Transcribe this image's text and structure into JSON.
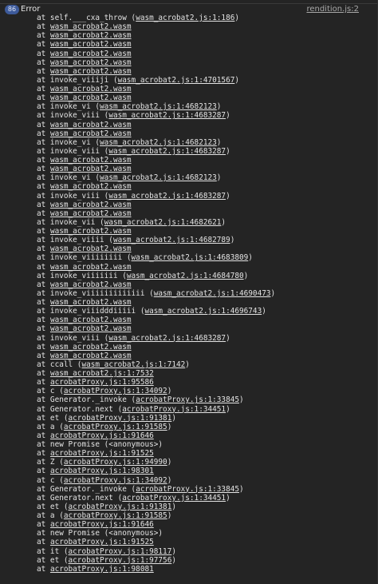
{
  "header": {
    "count": "86",
    "label": "Error",
    "source": "rendition.js:2"
  },
  "stack": [
    {
      "prefix": "at self.___cxa_throw (",
      "link": "wasm_acrobat2.js:1:186",
      "suffix": ")"
    },
    {
      "prefix": "at ",
      "link": "wasm_acrobat2.wasm",
      "suffix": ""
    },
    {
      "prefix": "at ",
      "link": "wasm_acrobat2.wasm",
      "suffix": ""
    },
    {
      "prefix": "at ",
      "link": "wasm_acrobat2.wasm",
      "suffix": ""
    },
    {
      "prefix": "at ",
      "link": "wasm_acrobat2.wasm",
      "suffix": ""
    },
    {
      "prefix": "at ",
      "link": "wasm_acrobat2.wasm",
      "suffix": ""
    },
    {
      "prefix": "at ",
      "link": "wasm_acrobat2.wasm",
      "suffix": ""
    },
    {
      "prefix": "at invoke_viiiji (",
      "link": "wasm_acrobat2.js:1:4701567",
      "suffix": ")"
    },
    {
      "prefix": "at ",
      "link": "wasm_acrobat2.wasm",
      "suffix": ""
    },
    {
      "prefix": "at ",
      "link": "wasm_acrobat2.wasm",
      "suffix": ""
    },
    {
      "prefix": "at invoke_vi (",
      "link": "wasm_acrobat2.js:1:4682123",
      "suffix": ")"
    },
    {
      "prefix": "at invoke_viii (",
      "link": "wasm_acrobat2.js:1:4683287",
      "suffix": ")"
    },
    {
      "prefix": "at ",
      "link": "wasm_acrobat2.wasm",
      "suffix": ""
    },
    {
      "prefix": "at ",
      "link": "wasm_acrobat2.wasm",
      "suffix": ""
    },
    {
      "prefix": "at invoke_vi (",
      "link": "wasm_acrobat2.js:1:4682123",
      "suffix": ")"
    },
    {
      "prefix": "at invoke_viii (",
      "link": "wasm_acrobat2.js:1:4683287",
      "suffix": ")"
    },
    {
      "prefix": "at ",
      "link": "wasm_acrobat2.wasm",
      "suffix": ""
    },
    {
      "prefix": "at ",
      "link": "wasm_acrobat2.wasm",
      "suffix": ""
    },
    {
      "prefix": "at invoke_vi (",
      "link": "wasm_acrobat2.js:1:4682123",
      "suffix": ")"
    },
    {
      "prefix": "at ",
      "link": "wasm_acrobat2.wasm",
      "suffix": ""
    },
    {
      "prefix": "at invoke_viii (",
      "link": "wasm_acrobat2.js:1:4683287",
      "suffix": ")"
    },
    {
      "prefix": "at ",
      "link": "wasm_acrobat2.wasm",
      "suffix": ""
    },
    {
      "prefix": "at ",
      "link": "wasm_acrobat2.wasm",
      "suffix": ""
    },
    {
      "prefix": "at invoke_vii (",
      "link": "wasm_acrobat2.js:1:4682621",
      "suffix": ")"
    },
    {
      "prefix": "at ",
      "link": "wasm_acrobat2.wasm",
      "suffix": ""
    },
    {
      "prefix": "at invoke_viiii (",
      "link": "wasm_acrobat2.js:1:4682789",
      "suffix": ")"
    },
    {
      "prefix": "at ",
      "link": "wasm_acrobat2.wasm",
      "suffix": ""
    },
    {
      "prefix": "at invoke_viiiiiiii (",
      "link": "wasm_acrobat2.js:1:4683809",
      "suffix": ")"
    },
    {
      "prefix": "at ",
      "link": "wasm_acrobat2.wasm",
      "suffix": ""
    },
    {
      "prefix": "at invoke_viiiiiii (",
      "link": "wasm_acrobat2.js:1:4684780",
      "suffix": ")"
    },
    {
      "prefix": "at ",
      "link": "wasm_acrobat2.wasm",
      "suffix": ""
    },
    {
      "prefix": "at invoke_viiiiiiiiiiiii (",
      "link": "wasm_acrobat2.js:1:4690473",
      "suffix": ")"
    },
    {
      "prefix": "at ",
      "link": "wasm_acrobat2.wasm",
      "suffix": ""
    },
    {
      "prefix": "at invoke_viiidddiiiii (",
      "link": "wasm_acrobat2.js:1:4696743",
      "suffix": ")"
    },
    {
      "prefix": "at ",
      "link": "wasm_acrobat2.wasm",
      "suffix": ""
    },
    {
      "prefix": "at ",
      "link": "wasm_acrobat2.wasm",
      "suffix": ""
    },
    {
      "prefix": "at invoke_viii (",
      "link": "wasm_acrobat2.js:1:4683287",
      "suffix": ")"
    },
    {
      "prefix": "at ",
      "link": "wasm_acrobat2.wasm",
      "suffix": ""
    },
    {
      "prefix": "at ",
      "link": "wasm_acrobat2.wasm",
      "suffix": ""
    },
    {
      "prefix": "at ccall (",
      "link": "wasm_acrobat2.js:1:7142",
      "suffix": ")"
    },
    {
      "prefix": "at ",
      "link": "wasm_acrobat2.js:1:7532",
      "suffix": ""
    },
    {
      "prefix": "at ",
      "link": "acrobatProxy.js:1:95586",
      "suffix": ""
    },
    {
      "prefix": "at c (",
      "link": "acrobatProxy.js:1:34092",
      "suffix": ")"
    },
    {
      "prefix": "at Generator._invoke (",
      "link": "acrobatProxy.js:1:33845",
      "suffix": ")"
    },
    {
      "prefix": "at Generator.next (",
      "link": "acrobatProxy.js:1:34451",
      "suffix": ")"
    },
    {
      "prefix": "at et (",
      "link": "acrobatProxy.js:1:91381",
      "suffix": ")"
    },
    {
      "prefix": "at a (",
      "link": "acrobatProxy.js:1:91585",
      "suffix": ")"
    },
    {
      "prefix": "at ",
      "link": "acrobatProxy.js:1:91646",
      "suffix": ""
    },
    {
      "prefix": "at new Promise (<anonymous>)",
      "link": "",
      "suffix": ""
    },
    {
      "prefix": "at ",
      "link": "acrobatProxy.js:1:91525",
      "suffix": ""
    },
    {
      "prefix": "at Z (",
      "link": "acrobatProxy.js:1:94990",
      "suffix": ")"
    },
    {
      "prefix": "at ",
      "link": "acrobatProxy.js:1:98301",
      "suffix": ""
    },
    {
      "prefix": "at c (",
      "link": "acrobatProxy.js:1:34092",
      "suffix": ")"
    },
    {
      "prefix": "at Generator._invoke (",
      "link": "acrobatProxy.js:1:33845",
      "suffix": ")"
    },
    {
      "prefix": "at Generator.next (",
      "link": "acrobatProxy.js:1:34451",
      "suffix": ")"
    },
    {
      "prefix": "at et (",
      "link": "acrobatProxy.js:1:91381",
      "suffix": ")"
    },
    {
      "prefix": "at a (",
      "link": "acrobatProxy.js:1:91585",
      "suffix": ")"
    },
    {
      "prefix": "at ",
      "link": "acrobatProxy.js:1:91646",
      "suffix": ""
    },
    {
      "prefix": "at new Promise (<anonymous>)",
      "link": "",
      "suffix": ""
    },
    {
      "prefix": "at ",
      "link": "acrobatProxy.js:1:91525",
      "suffix": ""
    },
    {
      "prefix": "at it (",
      "link": "acrobatProxy.js:1:98117",
      "suffix": ")"
    },
    {
      "prefix": "at et (",
      "link": "acrobatProxy.js:1:97756",
      "suffix": ")"
    },
    {
      "prefix": "at ",
      "link": "acrobatProxy.js:1:98081",
      "suffix": ""
    }
  ]
}
